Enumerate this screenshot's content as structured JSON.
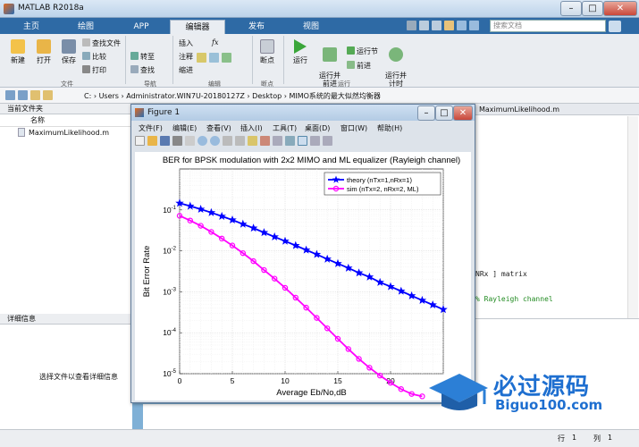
{
  "window": {
    "title": "MATLAB R2018a"
  },
  "tabs": [
    {
      "label": "主页"
    },
    {
      "label": "绘图"
    },
    {
      "label": "APP"
    },
    {
      "label": "编辑器"
    },
    {
      "label": "发布"
    },
    {
      "label": "视图"
    }
  ],
  "search": {
    "placeholder": "搜索文档"
  },
  "toolstrip": {
    "file": {
      "new": "新建",
      "open": "打开",
      "save": "保存",
      "find_files": "查找文件",
      "compare": "比较",
      "print": "打印",
      "group": "文件"
    },
    "nav": {
      "goto": "转至",
      "find": "查找",
      "group": "导航"
    },
    "edit": {
      "insert": "插入",
      "comment": "注释",
      "indent": "缩进",
      "fx": "fx",
      "group": "编辑"
    },
    "breakpoints": {
      "label": "断点",
      "group": "断点"
    },
    "run": {
      "run": "运行",
      "run_advance": "运行并\n前进",
      "run_section": "运行节",
      "advance": "前进",
      "run_time": "运行并\n计时",
      "group": "运行"
    }
  },
  "pathbar": {
    "path": "C: › Users › Administrator.WIN7U-20180127Z › Desktop › MIMO系统的最大似然均衡器"
  },
  "current_folder": {
    "header": "当前文件夹",
    "column": "名称",
    "files": [
      "MaximumLikelihood.m"
    ]
  },
  "details": {
    "header": "详细信息",
    "hint": "选择文件以查看详细信息"
  },
  "editor": {
    "tab_file": "MaximumLikelihood.m",
    "code_snippets": [
      "NRx ] matrix",
      "% Rayleigh channel"
    ]
  },
  "figure": {
    "title": "Figure 1",
    "menu": [
      "文件(F)",
      "编辑(E)",
      "查看(V)",
      "插入(I)",
      "工具(T)",
      "桌面(D)",
      "窗口(W)",
      "帮助(H)"
    ]
  },
  "statusbar": {
    "row_label": "行",
    "row": "1",
    "col_label": "列",
    "col": "1"
  },
  "watermark": {
    "name": "必过源码",
    "url": "Biguo100.com"
  },
  "chart_data": {
    "type": "line",
    "title": "BER for BPSK modulation with 2x2 MIMO and ML equalizer (Rayleigh channel)",
    "xlabel": "Average Eb/No,dB",
    "ylabel": "Bit Error Rate",
    "xlim": [
      0,
      25
    ],
    "ylim": [
      1e-05,
      1
    ],
    "y_scale": "log",
    "grid": true,
    "legend_position": "top-right",
    "x_ticks": [
      "0",
      "5",
      "10",
      "15",
      "20"
    ],
    "y_ticks": [
      "10^-1",
      "10^-2",
      "10^-3",
      "10^-4",
      "10^-5"
    ],
    "series": [
      {
        "name": "theory (nTx=1,nRx=1)",
        "color": "#0000ff",
        "marker": "star",
        "x": [
          0,
          1,
          2,
          3,
          4,
          5,
          6,
          7,
          8,
          9,
          10,
          11,
          12,
          13,
          14,
          15,
          16,
          17,
          18,
          19,
          20,
          21,
          22,
          23,
          24,
          25
        ],
        "y": [
          0.146,
          0.124,
          0.104,
          0.086,
          0.07,
          0.057,
          0.045,
          0.036,
          0.028,
          0.022,
          0.0173,
          0.0135,
          0.0105,
          0.0082,
          0.0063,
          0.0049,
          0.0038,
          0.0029,
          0.0023,
          0.0017,
          0.00134,
          0.00104,
          0.0008,
          0.00062,
          0.00048,
          0.00037
        ]
      },
      {
        "name": "sim (nTx=2, nRx=2, ML)",
        "color": "#ff00ff",
        "marker": "circle",
        "x": [
          0,
          1,
          2,
          3,
          4,
          5,
          6,
          7,
          8,
          9,
          10,
          11,
          12,
          13,
          14,
          15,
          16,
          17,
          18,
          19,
          20,
          21,
          22,
          23
        ],
        "y": [
          0.072,
          0.055,
          0.041,
          0.029,
          0.02,
          0.0135,
          0.0088,
          0.0056,
          0.0034,
          0.0021,
          0.00125,
          0.00072,
          0.00041,
          0.00023,
          0.000128,
          7.1e-05,
          4e-05,
          2.3e-05,
          1.4e-05,
          9e-06,
          6e-06,
          4.2e-06,
          3.2e-06,
          2.8e-06
        ]
      }
    ]
  }
}
